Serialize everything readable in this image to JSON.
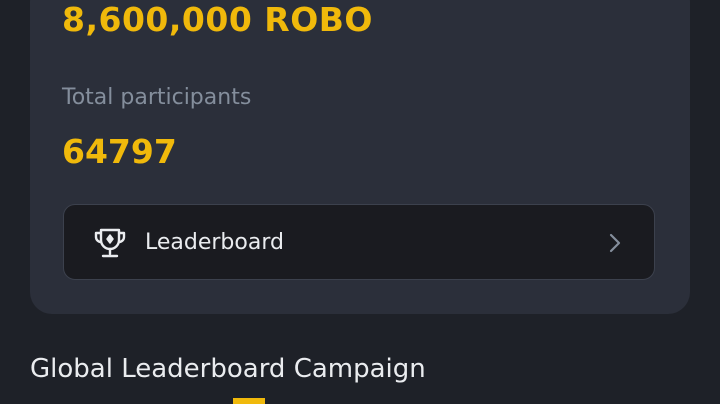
{
  "campaign": {
    "prize_pool": "8,600,000 ROBO",
    "participants_label": "Total participants",
    "participants_value": "64797",
    "leaderboard_label": "Leaderboard"
  },
  "section": {
    "title": "Global Leaderboard Campaign"
  },
  "icons": {
    "leaderboard": "trophy-icon",
    "arrow": "chevron-right-icon"
  },
  "colors": {
    "accent": "#f0b90b",
    "background": "#1e2128",
    "card": "#2b2f3a",
    "button": "#1a1b20",
    "muted_text": "#848e9c",
    "primary_text": "#eaecef"
  }
}
